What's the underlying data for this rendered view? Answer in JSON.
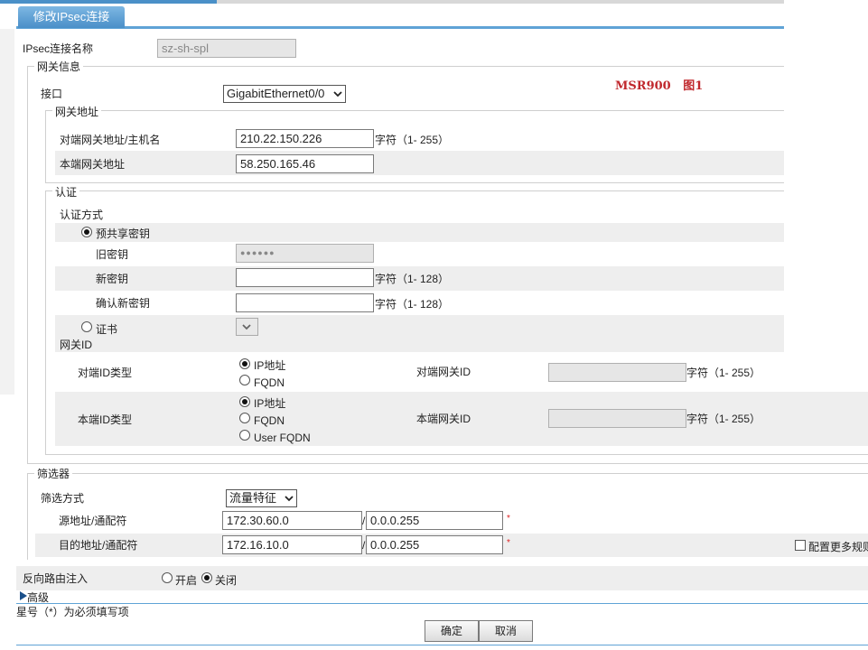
{
  "tab": {
    "title": "修改IPsec连接"
  },
  "conn_name": {
    "label": "IPsec连接名称",
    "value": "sz-sh-spl"
  },
  "gateway": {
    "legend": "网关信息",
    "interface_label": "接口",
    "interface_value": "GigabitEthernet0/0",
    "annotation": "MSR900   图1",
    "address_legend": "网关地址",
    "peer_label": "对端网关地址/主机名",
    "peer_value": "210.22.150.226",
    "peer_hint": "字符（1- 255）",
    "local_label": "本端网关地址",
    "local_value": "58.250.165.46"
  },
  "auth": {
    "legend": "认证",
    "method_label": "认证方式",
    "psk_label": "预共享密钥",
    "old_key_label": "旧密钥",
    "old_key_value": "●●●●●●",
    "new_key_label": "新密钥",
    "new_key_hint": "字符（1- 128）",
    "confirm_key_label": "确认新密钥",
    "confirm_key_hint": "字符（1- 128）",
    "cert_label": "证书"
  },
  "gateway_id": {
    "title": "网关ID",
    "peer_type_label": "对端ID类型",
    "peer_opt_ip": "IP地址",
    "peer_opt_fqdn": "FQDN",
    "peer_gw_label": "对端网关ID",
    "peer_gw_hint": "字符（1- 255）",
    "local_type_label": "本端ID类型",
    "local_opt_ip": "IP地址",
    "local_opt_fqdn": "FQDN",
    "local_opt_userfqdn": "User FQDN",
    "local_gw_label": "本端网关ID",
    "local_gw_hint": "字符（1- 255）"
  },
  "filter": {
    "legend": "筛选器",
    "method_label": "筛选方式",
    "method_value": "流量特征",
    "src_label": "源地址/通配符",
    "src_addr": "172.30.60.0",
    "src_wild": "0.0.0.255",
    "dst_label": "目的地址/通配符",
    "dst_addr": "172.16.10.0",
    "dst_wild": "0.0.0.255",
    "slash": "/",
    "required_mark": "*",
    "more_label": "配置更多规则"
  },
  "rri": {
    "label": "反向路由注入",
    "on_label": "开启",
    "off_label": "关闭"
  },
  "advanced": {
    "label": "高级"
  },
  "footer": {
    "note": "星号（*）为必须填写项",
    "ok_label": "确定",
    "cancel_label": "取消"
  }
}
